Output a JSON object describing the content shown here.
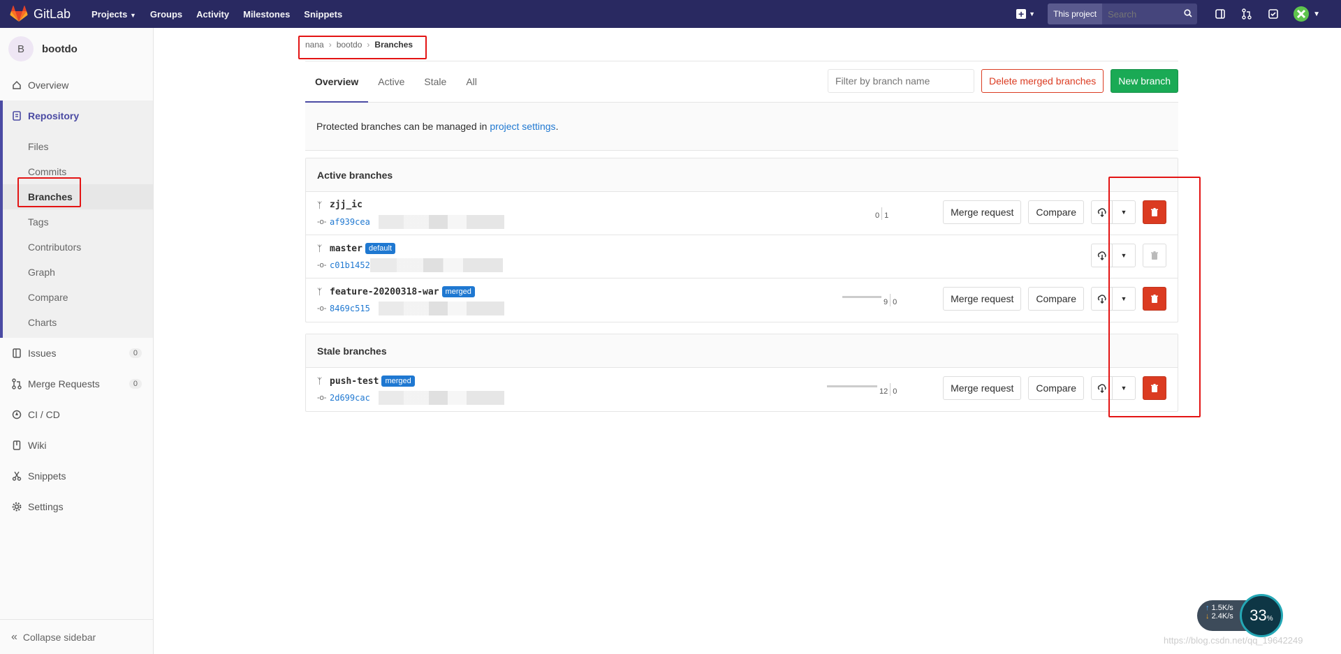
{
  "topnav": {
    "brand": "GitLab",
    "links": [
      "Projects",
      "Groups",
      "Activity",
      "Milestones",
      "Snippets"
    ],
    "search_scope": "This project",
    "search_placeholder": "Search"
  },
  "sidebar": {
    "project_initial": "B",
    "project_name": "bootdo",
    "overview": "Overview",
    "repository": "Repository",
    "repo_items": [
      "Files",
      "Commits",
      "Branches",
      "Tags",
      "Contributors",
      "Graph",
      "Compare",
      "Charts"
    ],
    "issues": "Issues",
    "issues_count": "0",
    "merge_requests": "Merge Requests",
    "mr_count": "0",
    "cicd": "CI / CD",
    "wiki": "Wiki",
    "snippets": "Snippets",
    "settings": "Settings",
    "collapse": "Collapse sidebar"
  },
  "breadcrumb": {
    "items": [
      "nana",
      "bootdo"
    ],
    "current": "Branches"
  },
  "tabs": [
    "Overview",
    "Active",
    "Stale",
    "All"
  ],
  "filter_placeholder": "Filter by branch name",
  "buttons": {
    "delete_merged": "Delete merged branches",
    "new_branch": "New branch",
    "merge_request": "Merge request",
    "compare": "Compare"
  },
  "info": {
    "text": "Protected branches can be managed in",
    "link": "project settings",
    "end": "."
  },
  "active_branches": {
    "title": "Active branches",
    "rows": [
      {
        "name": "zjj_ic",
        "badge": "",
        "sha": "af939cea",
        "behind": "0",
        "ahead": "1"
      },
      {
        "name": "master",
        "badge": "default",
        "sha": "c01b1452",
        "behind": "",
        "ahead": ""
      },
      {
        "name": "feature-20200318-war",
        "badge": "merged",
        "sha": "8469c515",
        "behind": "9",
        "ahead": "0"
      }
    ]
  },
  "stale_branches": {
    "title": "Stale branches",
    "rows": [
      {
        "name": "push-test",
        "badge": "merged",
        "sha": "2d699cac",
        "behind": "12",
        "ahead": "0"
      }
    ]
  },
  "net_widget": {
    "up": "1.5K/s",
    "down": "2.4K/s",
    "percent": "33",
    "unit": "%"
  },
  "watermark": "https://blog.csdn.net/qq_19642249"
}
